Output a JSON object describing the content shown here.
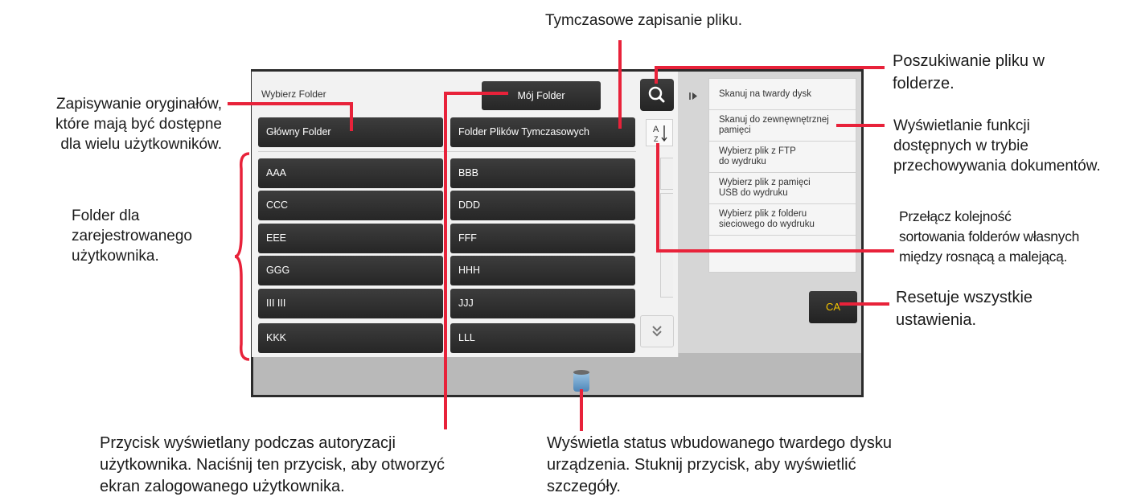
{
  "callouts": {
    "temp_save": "Tymczasowe zapisanie pliku.",
    "search": [
      "Poszukiwanie pliku w",
      "folderze."
    ],
    "shared": [
      "Zapisywanie oryginałów,",
      "które mają być dostępne",
      "dla wielu użytkowników."
    ],
    "functions": [
      "Wyświetlanie funkcji",
      "dostępnych w trybie",
      "przechowywania dokumentów."
    ],
    "registered": [
      "Folder dla",
      "zarejestrowanego",
      "użytkownika."
    ],
    "sort": [
      "Przełącz kolejność",
      "sortowania folderów własnych",
      "między rosnącą a malejącą."
    ],
    "reset": [
      "Resetuje wszystkie",
      "ustawienia."
    ],
    "my_folder": [
      "Przycisk wyświetlany podczas autoryzacji",
      "użytkownika. Naciśnij ten przycisk, aby otworzyć",
      "ekran zalogowanego użytkownika."
    ],
    "hdd": [
      "Wyświetla status wbudowanego twardego dysku",
      "urządzenia. Stuknij przycisk, aby wyświetlić",
      "szczegóły."
    ]
  },
  "screen": {
    "select_folder_label": "Wybierz Folder",
    "my_folder_button": "Mój Folder",
    "main_folder_button": "Główny Folder",
    "temp_folder_button": "Folder Plików Tymczasowych",
    "sort_icon_text": "A Z",
    "folders": [
      "AAA",
      "BBB",
      "CCC",
      "DDD",
      "EEE",
      "FFF",
      "GGG",
      "HHH",
      "III III",
      "JJJ",
      "KKK",
      "LLL"
    ],
    "side_menu": [
      [
        "Skanuj na twardy dysk"
      ],
      [
        "Skanuj do zewnęwnętrznej",
        "pamięci"
      ],
      [
        "Wybierz plik z FTP",
        "do wydruku"
      ],
      [
        "Wybierz plik z pamięci",
        "USB do wydruku"
      ],
      [
        "Wybierz plik z folderu",
        "sieciowego do wydruku"
      ]
    ],
    "ca_button": "CA"
  },
  "colors": {
    "leader": "#e8223a",
    "ca_text": "#f5c400",
    "button": "#2f2f2f"
  }
}
